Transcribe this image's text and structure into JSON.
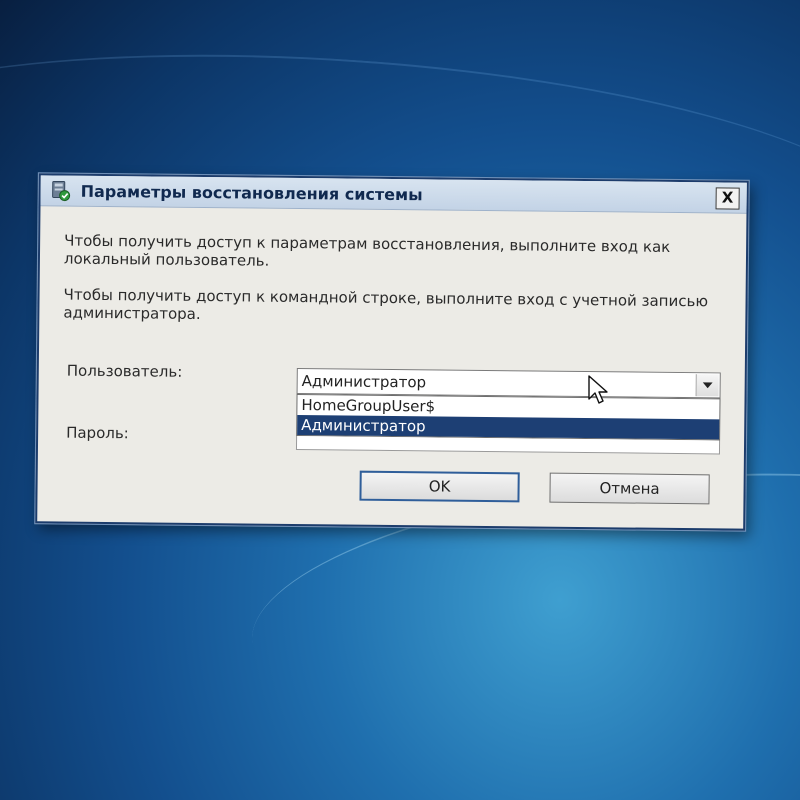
{
  "window": {
    "title": "Параметры восстановления системы",
    "close_label": "X"
  },
  "messages": {
    "recovery_access": "Чтобы получить доступ к параметрам восстановления, выполните вход как локальный пользователь.",
    "cmd_access": "Чтобы получить доступ к командной строке, выполните вход с учетной записью администратора."
  },
  "form": {
    "user_label": "Пользователь:",
    "user_selected": "Администратор",
    "user_options": [
      "HomeGroupUser$",
      "Администратор"
    ],
    "password_label": "Пароль:",
    "password_value": ""
  },
  "buttons": {
    "ok_label": "OK",
    "cancel_label": "Отмена"
  },
  "colors": {
    "selection_highlight": "#1d3f74",
    "desktop_blue": "#1f6fae"
  }
}
